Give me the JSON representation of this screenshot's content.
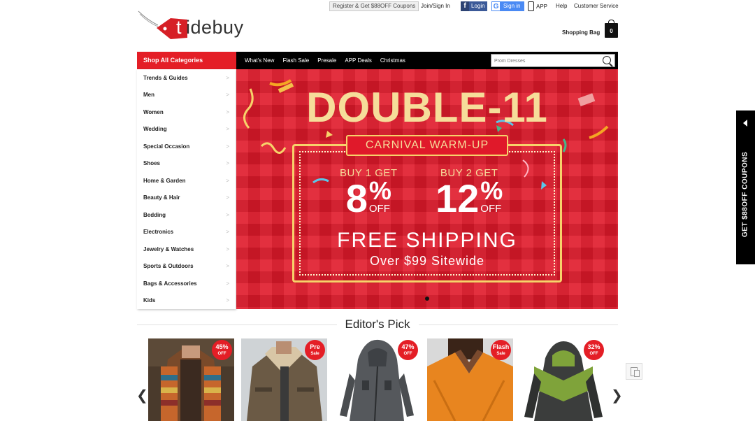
{
  "topbar": {
    "register_coupon": "Register & Get $88OFF Coupons",
    "join": "Join/Sign In",
    "facebook_login": "Login",
    "google_signin": "Sign in",
    "app": "APP",
    "help": "Help",
    "customer_service": "Customer Service"
  },
  "logo": {
    "letter_t": "t",
    "rest": "idebuy"
  },
  "bag": {
    "label": "Shopping Bag",
    "count": "0"
  },
  "nav": {
    "shop_all": "Shop All Categories",
    "links": [
      "What's New",
      "Flash Sale",
      "Presale",
      "APP Deals",
      "Christmas"
    ],
    "search_placeholder": "Prom Dresses"
  },
  "categories": [
    "Trends & Guides",
    "Men",
    "Women",
    "Wedding",
    "Special Occasion",
    "Shoes",
    "Home & Garden",
    "Beauty & Hair",
    "Bedding",
    "Electronics",
    "Jewelry & Watches",
    "Sports & Outdoors",
    "Bags & Accessories",
    "Kids"
  ],
  "category_arrow": ">",
  "banner": {
    "headline": "DOUBLE-11",
    "subtitle": "CARNIVAL WARM-UP",
    "offer1_label": "BUY 1 GET",
    "offer1_value": "8",
    "offer2_label": "BUY 2 GET",
    "offer2_value": "12",
    "percent": "%",
    "off": "OFF",
    "free_shipping": "FREE SHIPPING",
    "sitewide": "Over $99 Sitewide",
    "colors": {
      "background": "#e0192a",
      "gold": "#f6dd9a"
    }
  },
  "editors_pick": {
    "title": "Editor's Pick",
    "prev_arrow": "❮",
    "next_arrow": "❯",
    "products": [
      {
        "badge_value": "45%",
        "badge_label": "OFF",
        "item": "striped knit cardigan"
      },
      {
        "badge_value": "Pre",
        "badge_label": "Sale",
        "item": "fleece lined aviator jacket"
      },
      {
        "badge_value": "47%",
        "badge_label": "OFF",
        "item": "grey zip hooded coat"
      },
      {
        "badge_value": "Flash",
        "badge_label": "Sale",
        "item": "orange wrap sweater"
      },
      {
        "badge_value": "32%",
        "badge_label": "OFF",
        "item": "green colorblock hoodie"
      }
    ]
  },
  "side_tab": {
    "label": "GET $88OFF COUPONS"
  }
}
